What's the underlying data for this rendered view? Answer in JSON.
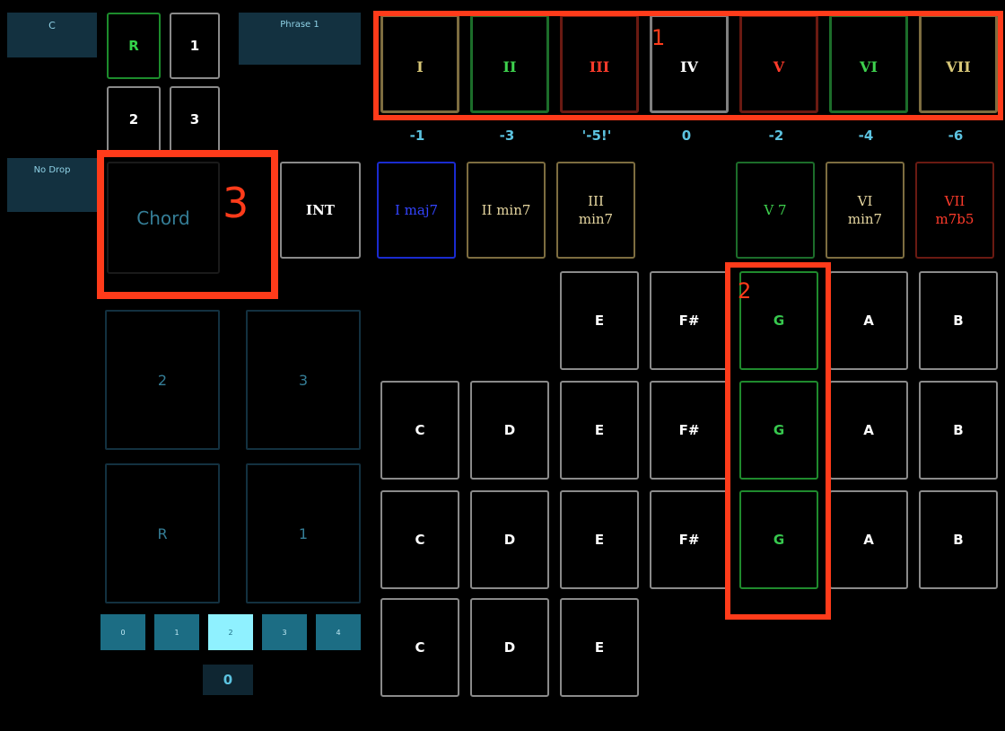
{
  "left": {
    "key_button": "C",
    "drop_button": "No Drop",
    "phrase_button": "Phrase 1",
    "voice_buttons": [
      {
        "label": "R",
        "color": "#34d34a"
      },
      {
        "label": "1",
        "color": "#ffffff"
      },
      {
        "label": "2",
        "color": "#ffffff"
      },
      {
        "label": "3",
        "color": "#ffffff"
      }
    ],
    "chord_mode": "Chord",
    "int_button": "INT",
    "pads": [
      "2",
      "3",
      "R",
      "1"
    ],
    "page_tabs": [
      "0",
      "1",
      "2",
      "3",
      "4"
    ],
    "selected_tab": "2",
    "value_readout": "0"
  },
  "degrees": [
    {
      "label": "I",
      "color": "#d9c878",
      "border": "#7d6d40"
    },
    {
      "label": "II",
      "color": "#3ed24e",
      "border": "#1c6d2a"
    },
    {
      "label": "III",
      "color": "#ff3b2b",
      "border": "#6a1a12"
    },
    {
      "label": "IV",
      "color": "#ffffff",
      "border": "#808080"
    },
    {
      "label": "V",
      "color": "#ff3b2b",
      "border": "#6a1a12"
    },
    {
      "label": "VI",
      "color": "#3ed24e",
      "border": "#1c6d2a"
    },
    {
      "label": "VII",
      "color": "#d9c878",
      "border": "#7d6d40"
    }
  ],
  "offsets": [
    "-1",
    "-3",
    "'-5!'",
    "0",
    "-2",
    "-4",
    "-6"
  ],
  "chords": [
    {
      "label": "I maj7",
      "color": "#3344ff",
      "border": "#1a2bd0"
    },
    {
      "label": "II min7",
      "color": "#e6d6a0",
      "border": "#7d6d40"
    },
    {
      "label": "III\nmin7",
      "color": "#e6d6a0",
      "border": "#7d6d40"
    },
    {
      "label": "V 7",
      "color": "#3ed24e",
      "border": "#1c6d2a"
    },
    {
      "label": "VI\nmin7",
      "color": "#e6d6a0",
      "border": "#7d6d40"
    },
    {
      "label": "VII\nm7b5",
      "color": "#ff3b2b",
      "border": "#6a1a12"
    }
  ],
  "note_rows": [
    [
      "E",
      "F#",
      "G",
      "A",
      "B"
    ],
    [
      "C",
      "D",
      "E",
      "F#",
      "G",
      "A",
      "B"
    ],
    [
      "C",
      "D",
      "E",
      "F#",
      "G",
      "A",
      "B"
    ],
    [
      "C",
      "D",
      "E"
    ]
  ],
  "annotations": {
    "one": "1",
    "two": "2",
    "three": "3"
  }
}
